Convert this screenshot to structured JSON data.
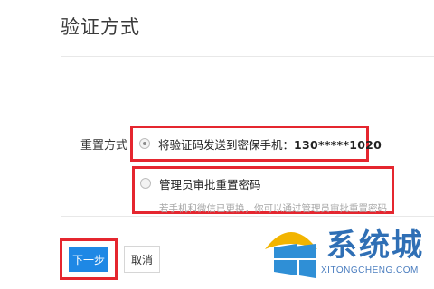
{
  "page": {
    "title": "验证方式"
  },
  "form": {
    "reset_label": "重置方式",
    "options": [
      {
        "text": "将验证码发送到密保手机：",
        "phone": "130*****1020",
        "selected": true
      },
      {
        "text": "管理员审批重置密码",
        "hint": "若手机和微信已更换，你可以通过管理员审批重置密码",
        "selected": false
      }
    ]
  },
  "actions": {
    "next_label": "下一步",
    "cancel_label": "取消"
  },
  "watermark": {
    "name_cn": "系统城",
    "domain": "XITONGCHENG.COM"
  },
  "colors": {
    "primary_button": "#1e88e5",
    "highlight_border": "#e5262f"
  }
}
